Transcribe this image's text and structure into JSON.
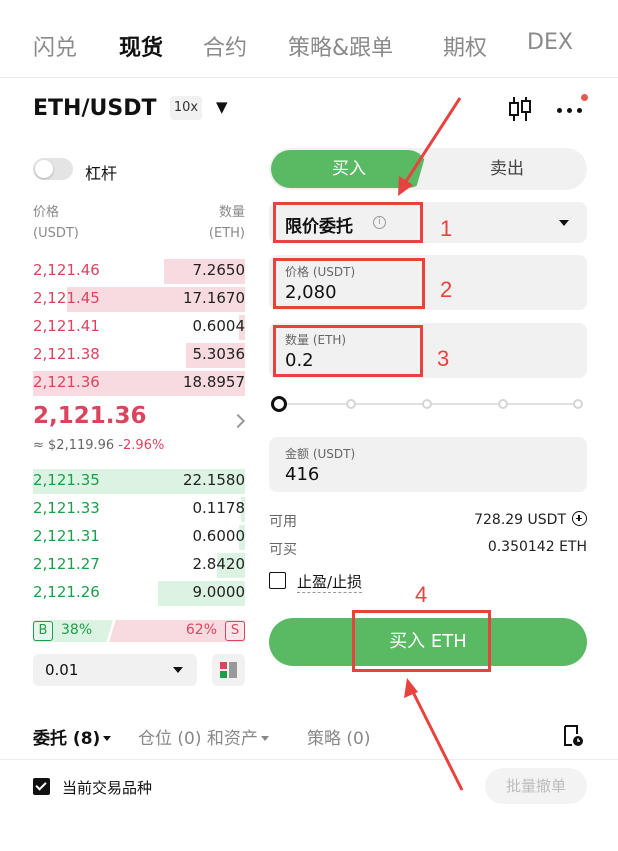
{
  "top_tabs": [
    "闪兑",
    "现货",
    "合约",
    "策略&跟单",
    "期权",
    "DEX"
  ],
  "pair": {
    "symbol": "ETH/USDT",
    "leverage": "10x"
  },
  "margin": {
    "label": "杠杆"
  },
  "orderbook": {
    "price_header": "价格",
    "price_unit": "(USDT)",
    "qty_header": "数量",
    "qty_unit": "(ETH)",
    "asks": [
      {
        "price": "2,121.46",
        "qty": "7.2650",
        "depth": 0.38
      },
      {
        "price": "2,121.45",
        "qty": "17.1670",
        "depth": 0.84
      },
      {
        "price": "2,121.41",
        "qty": "0.6004",
        "depth": 0.03
      },
      {
        "price": "2,121.38",
        "qty": "5.3036",
        "depth": 0.28
      },
      {
        "price": "2,121.36",
        "qty": "18.8957",
        "depth": 1.0
      }
    ],
    "last_price": "2,121.36",
    "fiat_price": "≈ $2,119.96",
    "change": "-2.96%",
    "bids": [
      {
        "price": "2,121.35",
        "qty": "22.1580",
        "depth": 1.0
      },
      {
        "price": "2,121.33",
        "qty": "0.1178",
        "depth": 0.02
      },
      {
        "price": "2,121.31",
        "qty": "0.6000",
        "depth": 0.03
      },
      {
        "price": "2,121.27",
        "qty": "2.8420",
        "depth": 0.13
      },
      {
        "price": "2,121.26",
        "qty": "9.0000",
        "depth": 0.41
      }
    ],
    "buy_badge": "B",
    "buy_ratio": "38%",
    "sell_ratio": "62%",
    "sell_badge": "S",
    "precision": "0.01"
  },
  "order_form": {
    "buy_tab": "买入",
    "sell_tab": "卖出",
    "order_type": "限价委托",
    "price_label": "价格 (USDT)",
    "price_value": "2,080",
    "qty_label": "数量 (ETH)",
    "qty_value": "0.2",
    "amount_label": "金额 (USDT)",
    "amount_value": "416",
    "available_label": "可用",
    "available_value": "728.29 USDT",
    "can_buy_label": "可买",
    "can_buy_value": "0.350142 ETH",
    "tpsl_label": "止盈/止损",
    "submit_label": "买入 ETH"
  },
  "bottom": {
    "tab_orders": "委托 (8)",
    "tab_positions": "仓位 (0) 和资产",
    "tab_strategy": "策略 (0)",
    "current_pair_label": "当前交易品种",
    "batch_cancel": "批量撤单"
  },
  "annotations": [
    "1",
    "2",
    "3",
    "4"
  ],
  "colors": {
    "buy_green": "#5ab963",
    "ask_red": "#d9455f",
    "bid_green": "#1d9e4a",
    "annotation_red": "#e8423f"
  }
}
